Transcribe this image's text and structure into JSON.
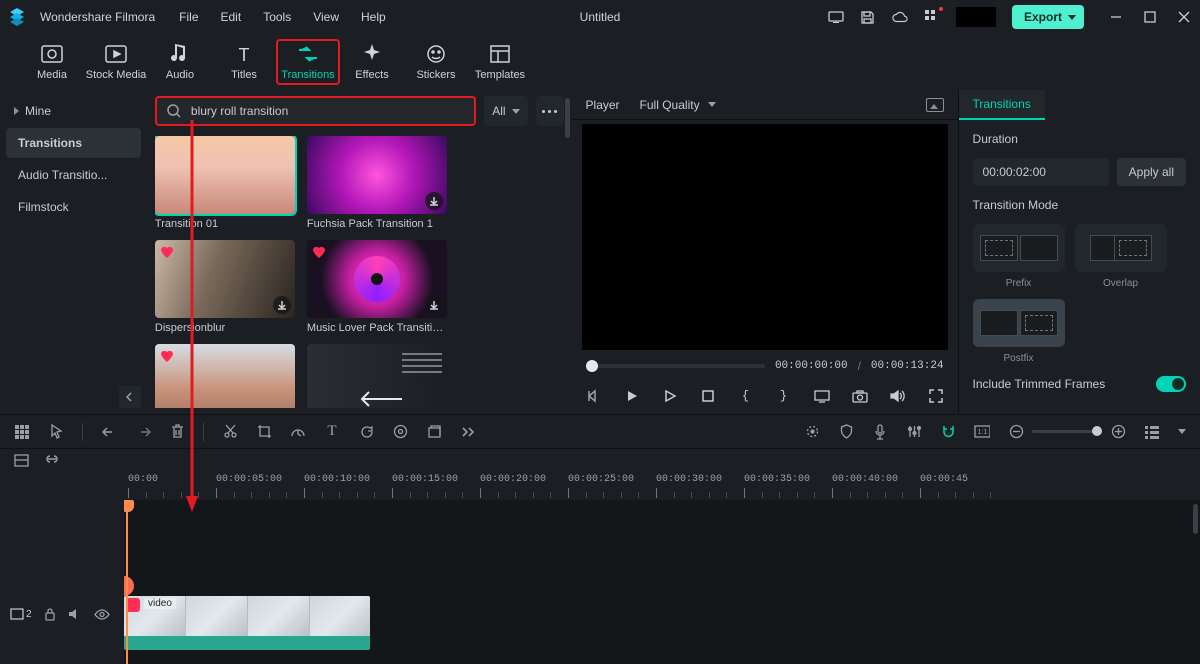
{
  "app": {
    "name": "Wondershare Filmora",
    "document": "Untitled"
  },
  "menu": {
    "file": "File",
    "edit": "Edit",
    "tools": "Tools",
    "view": "View",
    "help": "Help"
  },
  "export": {
    "label": "Export"
  },
  "tabs": {
    "media": "Media",
    "stock": "Stock Media",
    "audio": "Audio",
    "titles": "Titles",
    "transitions": "Transitions",
    "effects": "Effects",
    "stickers": "Stickers",
    "templates": "Templates"
  },
  "sidebar": {
    "mine": "Mine",
    "transitions": "Transitions",
    "audio_trans": "Audio Transitio...",
    "filmstock": "Filmstock"
  },
  "search": {
    "value": "blury roll transition",
    "filter_label": "All"
  },
  "cards": [
    {
      "label": "Transition 01"
    },
    {
      "label": "Fuchsia Pack Transition 1"
    },
    {
      "label": "Dispersionblur"
    },
    {
      "label": "Music Lover Pack Transition ..."
    },
    {
      "label": ""
    },
    {
      "label": ""
    }
  ],
  "player": {
    "title": "Player",
    "quality": "Full Quality",
    "time_current": "00:00:00:00",
    "time_total": "00:00:13:24"
  },
  "panel": {
    "tab": "Transitions",
    "duration_label": "Duration",
    "duration_value": "00:00:02:00",
    "apply_all": "Apply all",
    "mode_label": "Transition Mode",
    "modes": {
      "prefix": "Prefix",
      "overlap": "Overlap",
      "postfix": "Postfix"
    },
    "trimmed_label": "Include Trimmed Frames"
  },
  "timeline": {
    "ruler": [
      "00:00",
      "00:00:05:00",
      "00:00:10:00",
      "00:00:15:00",
      "00:00:20:00",
      "00:00:25:00",
      "00:00:30:00",
      "00:00:35:00",
      "00:00:40:00",
      "00:00:45"
    ],
    "track_badge": "2",
    "clip_label": "video"
  }
}
